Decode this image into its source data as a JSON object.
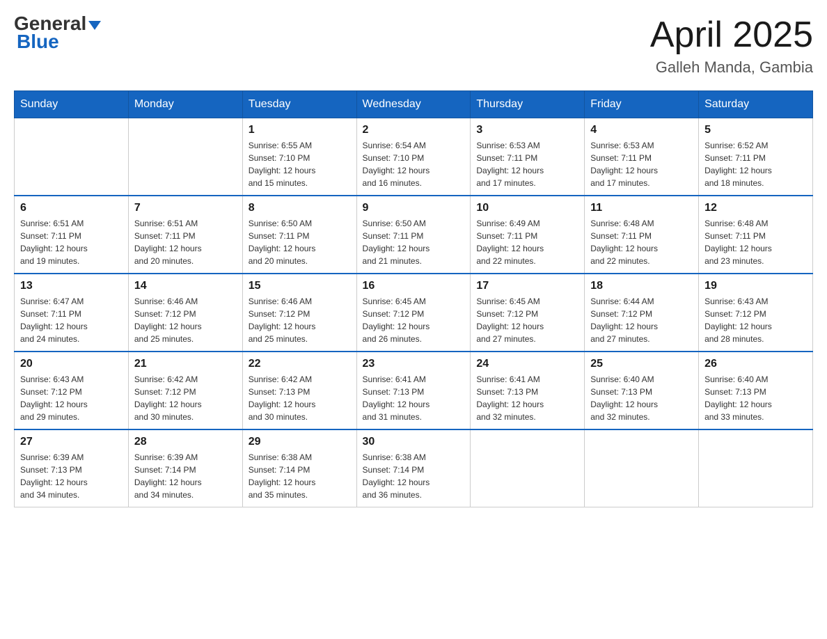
{
  "header": {
    "logo_general": "General",
    "logo_blue": "Blue",
    "month_title": "April 2025",
    "location": "Galleh Manda, Gambia"
  },
  "weekdays": [
    "Sunday",
    "Monday",
    "Tuesday",
    "Wednesday",
    "Thursday",
    "Friday",
    "Saturday"
  ],
  "weeks": [
    [
      {
        "day": "",
        "info": ""
      },
      {
        "day": "",
        "info": ""
      },
      {
        "day": "1",
        "info": "Sunrise: 6:55 AM\nSunset: 7:10 PM\nDaylight: 12 hours\nand 15 minutes."
      },
      {
        "day": "2",
        "info": "Sunrise: 6:54 AM\nSunset: 7:10 PM\nDaylight: 12 hours\nand 16 minutes."
      },
      {
        "day": "3",
        "info": "Sunrise: 6:53 AM\nSunset: 7:11 PM\nDaylight: 12 hours\nand 17 minutes."
      },
      {
        "day": "4",
        "info": "Sunrise: 6:53 AM\nSunset: 7:11 PM\nDaylight: 12 hours\nand 17 minutes."
      },
      {
        "day": "5",
        "info": "Sunrise: 6:52 AM\nSunset: 7:11 PM\nDaylight: 12 hours\nand 18 minutes."
      }
    ],
    [
      {
        "day": "6",
        "info": "Sunrise: 6:51 AM\nSunset: 7:11 PM\nDaylight: 12 hours\nand 19 minutes."
      },
      {
        "day": "7",
        "info": "Sunrise: 6:51 AM\nSunset: 7:11 PM\nDaylight: 12 hours\nand 20 minutes."
      },
      {
        "day": "8",
        "info": "Sunrise: 6:50 AM\nSunset: 7:11 PM\nDaylight: 12 hours\nand 20 minutes."
      },
      {
        "day": "9",
        "info": "Sunrise: 6:50 AM\nSunset: 7:11 PM\nDaylight: 12 hours\nand 21 minutes."
      },
      {
        "day": "10",
        "info": "Sunrise: 6:49 AM\nSunset: 7:11 PM\nDaylight: 12 hours\nand 22 minutes."
      },
      {
        "day": "11",
        "info": "Sunrise: 6:48 AM\nSunset: 7:11 PM\nDaylight: 12 hours\nand 22 minutes."
      },
      {
        "day": "12",
        "info": "Sunrise: 6:48 AM\nSunset: 7:11 PM\nDaylight: 12 hours\nand 23 minutes."
      }
    ],
    [
      {
        "day": "13",
        "info": "Sunrise: 6:47 AM\nSunset: 7:11 PM\nDaylight: 12 hours\nand 24 minutes."
      },
      {
        "day": "14",
        "info": "Sunrise: 6:46 AM\nSunset: 7:12 PM\nDaylight: 12 hours\nand 25 minutes."
      },
      {
        "day": "15",
        "info": "Sunrise: 6:46 AM\nSunset: 7:12 PM\nDaylight: 12 hours\nand 25 minutes."
      },
      {
        "day": "16",
        "info": "Sunrise: 6:45 AM\nSunset: 7:12 PM\nDaylight: 12 hours\nand 26 minutes."
      },
      {
        "day": "17",
        "info": "Sunrise: 6:45 AM\nSunset: 7:12 PM\nDaylight: 12 hours\nand 27 minutes."
      },
      {
        "day": "18",
        "info": "Sunrise: 6:44 AM\nSunset: 7:12 PM\nDaylight: 12 hours\nand 27 minutes."
      },
      {
        "day": "19",
        "info": "Sunrise: 6:43 AM\nSunset: 7:12 PM\nDaylight: 12 hours\nand 28 minutes."
      }
    ],
    [
      {
        "day": "20",
        "info": "Sunrise: 6:43 AM\nSunset: 7:12 PM\nDaylight: 12 hours\nand 29 minutes."
      },
      {
        "day": "21",
        "info": "Sunrise: 6:42 AM\nSunset: 7:12 PM\nDaylight: 12 hours\nand 30 minutes."
      },
      {
        "day": "22",
        "info": "Sunrise: 6:42 AM\nSunset: 7:13 PM\nDaylight: 12 hours\nand 30 minutes."
      },
      {
        "day": "23",
        "info": "Sunrise: 6:41 AM\nSunset: 7:13 PM\nDaylight: 12 hours\nand 31 minutes."
      },
      {
        "day": "24",
        "info": "Sunrise: 6:41 AM\nSunset: 7:13 PM\nDaylight: 12 hours\nand 32 minutes."
      },
      {
        "day": "25",
        "info": "Sunrise: 6:40 AM\nSunset: 7:13 PM\nDaylight: 12 hours\nand 32 minutes."
      },
      {
        "day": "26",
        "info": "Sunrise: 6:40 AM\nSunset: 7:13 PM\nDaylight: 12 hours\nand 33 minutes."
      }
    ],
    [
      {
        "day": "27",
        "info": "Sunrise: 6:39 AM\nSunset: 7:13 PM\nDaylight: 12 hours\nand 34 minutes."
      },
      {
        "day": "28",
        "info": "Sunrise: 6:39 AM\nSunset: 7:14 PM\nDaylight: 12 hours\nand 34 minutes."
      },
      {
        "day": "29",
        "info": "Sunrise: 6:38 AM\nSunset: 7:14 PM\nDaylight: 12 hours\nand 35 minutes."
      },
      {
        "day": "30",
        "info": "Sunrise: 6:38 AM\nSunset: 7:14 PM\nDaylight: 12 hours\nand 36 minutes."
      },
      {
        "day": "",
        "info": ""
      },
      {
        "day": "",
        "info": ""
      },
      {
        "day": "",
        "info": ""
      }
    ]
  ]
}
